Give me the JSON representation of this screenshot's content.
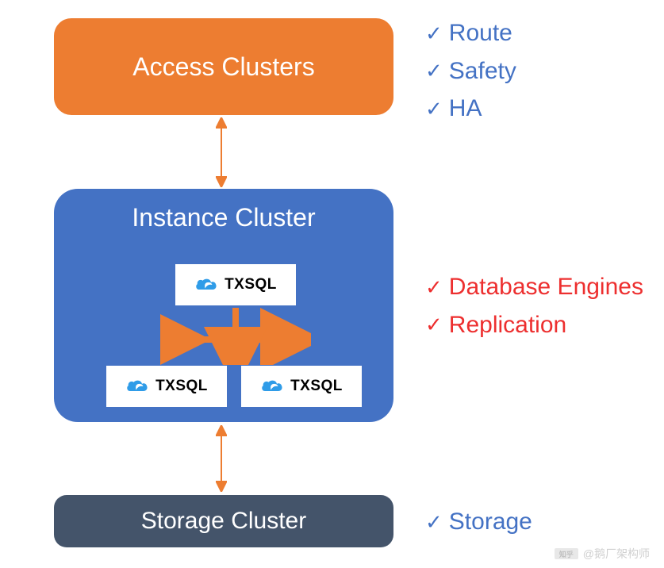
{
  "boxes": {
    "access": {
      "title": "Access Clusters"
    },
    "instance": {
      "title": "Instance Cluster",
      "badgeLabel": "TXSQL"
    },
    "storage": {
      "title": "Storage Cluster"
    }
  },
  "features": {
    "access": [
      {
        "label": "Route"
      },
      {
        "label": "Safety"
      },
      {
        "label": "HA"
      }
    ],
    "instance": [
      {
        "label": "Database Engines"
      },
      {
        "label": "Replication"
      }
    ],
    "storage": [
      {
        "label": "Storage"
      }
    ]
  },
  "watermark": {
    "logoText": "知乎",
    "text": "@鹅厂架构师"
  },
  "colors": {
    "orange": "#ED7D31",
    "blue": "#4472C4",
    "slate": "#44546A",
    "red": "#ED2F2F"
  }
}
